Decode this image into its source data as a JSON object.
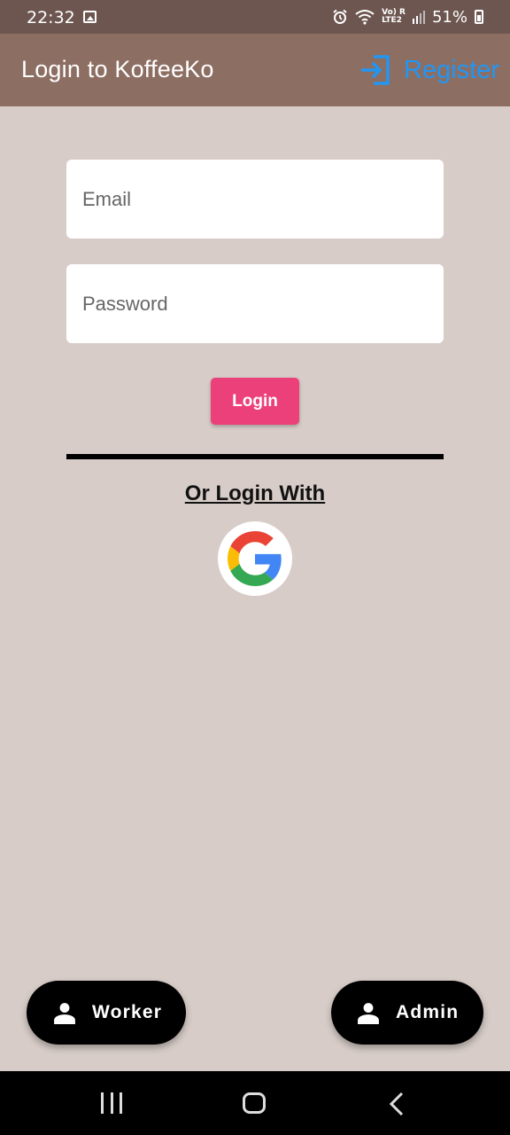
{
  "status_bar": {
    "time": "22:32",
    "network_label": "Vo) R\nLTE2",
    "battery": "51%"
  },
  "app_bar": {
    "title": "Login to KoffeeKo",
    "register_label": "Register",
    "register_icon": "login-icon",
    "accent_color": "#2196f3",
    "background_color": "#8d6e63"
  },
  "form": {
    "email_placeholder": "Email",
    "password_placeholder": "Password",
    "login_label": "Login",
    "login_color": "#ec407a"
  },
  "alt_login": {
    "label": "Or Login With",
    "provider_icon": "google-icon"
  },
  "roles": {
    "worker_label": "Worker",
    "admin_label": "Admin",
    "icon": "person-icon"
  },
  "nav": {
    "icons": [
      "recents-icon",
      "home-icon",
      "back-icon"
    ]
  },
  "theme": {
    "page_background": "#d7ccc8",
    "status_bar": "#6d5650"
  }
}
